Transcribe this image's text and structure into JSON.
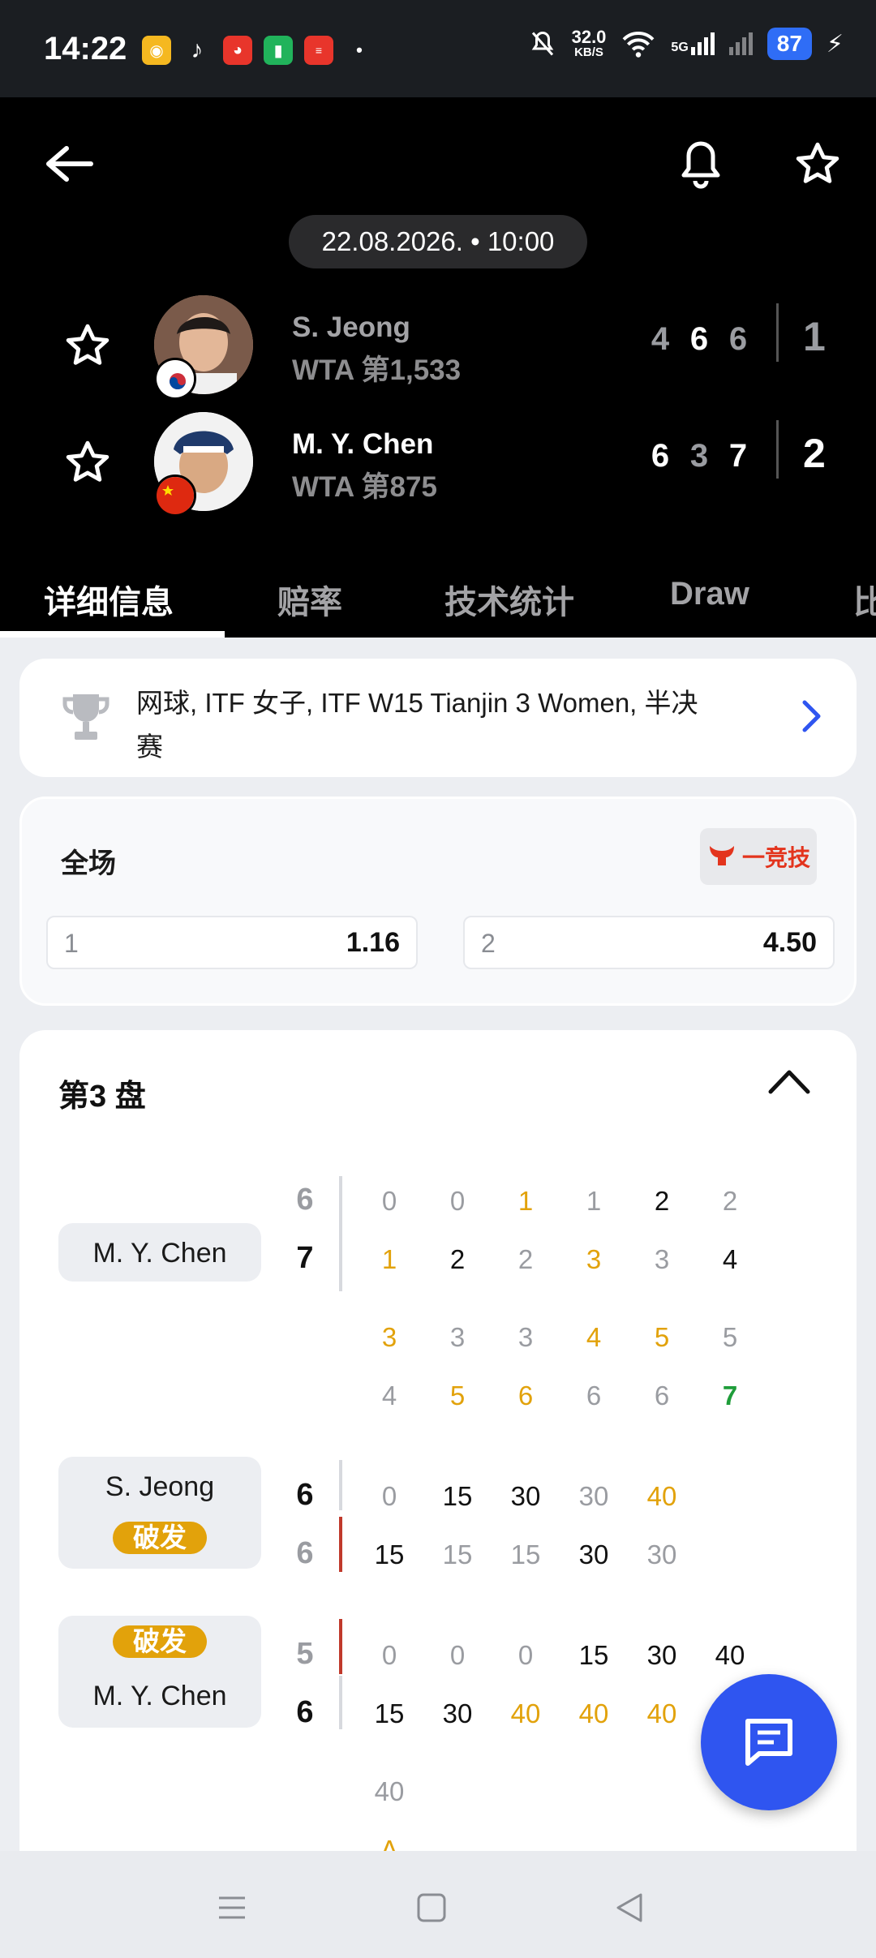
{
  "status_bar": {
    "time": "14:22",
    "net_speed": "32.0",
    "net_unit": "KB/S",
    "network": "5G",
    "battery": "87"
  },
  "header": {
    "datetime": "22.08.2026. • 10:00",
    "players": [
      {
        "name": "S. Jeong",
        "rank": "WTA 第1,533",
        "flag": "KR",
        "sets": [
          "4",
          "6",
          "6"
        ],
        "total": "1"
      },
      {
        "name": "M. Y. Chen",
        "rank": "WTA 第875",
        "flag": "CN",
        "sets": [
          "6",
          "3",
          "7"
        ],
        "total": "2"
      }
    ]
  },
  "tabs": [
    {
      "label": "详细信息",
      "active": true
    },
    {
      "label": "赔率"
    },
    {
      "label": "技术统计"
    },
    {
      "label": "Draw"
    },
    {
      "label": "比"
    }
  ],
  "competition": {
    "line1": "网球, ITF 女子, ITF W15 Tianjin 3 Women, 半决",
    "line2": "赛"
  },
  "odds": {
    "title": "全场",
    "brand": "一竞技",
    "options": [
      {
        "label": "1",
        "value": "1.16"
      },
      {
        "label": "2",
        "value": "4.50"
      }
    ]
  },
  "set_section": {
    "title": "第3 盘",
    "tiebreak": {
      "player": "M. Y. Chen",
      "score_top": "6",
      "score_bottom": "7",
      "row1": [
        "0",
        "0",
        "1",
        "1",
        "2",
        "2"
      ],
      "row2": [
        "1",
        "2",
        "2",
        "3",
        "3",
        "4"
      ],
      "row3": [
        "3",
        "3",
        "3",
        "4",
        "5",
        "5"
      ],
      "row4": [
        "4",
        "5",
        "6",
        "6",
        "6",
        "7"
      ]
    },
    "game_a": {
      "player": "S. Jeong",
      "badge": "破发",
      "score_top": "6",
      "score_bottom": "6",
      "row1": [
        "0",
        "15",
        "30",
        "30",
        "40"
      ],
      "row2": [
        "15",
        "15",
        "15",
        "30",
        "30"
      ]
    },
    "game_b": {
      "player": "M. Y. Chen",
      "badge": "破发",
      "score_top": "5",
      "score_bottom": "6",
      "row1": [
        "0",
        "0",
        "0",
        "15",
        "30",
        "40"
      ],
      "row2": [
        "15",
        "30",
        "40",
        "40",
        "40"
      ],
      "row3": [
        "40"
      ],
      "row4": [
        "A"
      ]
    }
  },
  "colors": {
    "accent_orange": "#e2a20b",
    "accent_blue": "#2f55f0",
    "accent_green": "#1f9d3a",
    "break_red": "#c0392b"
  }
}
